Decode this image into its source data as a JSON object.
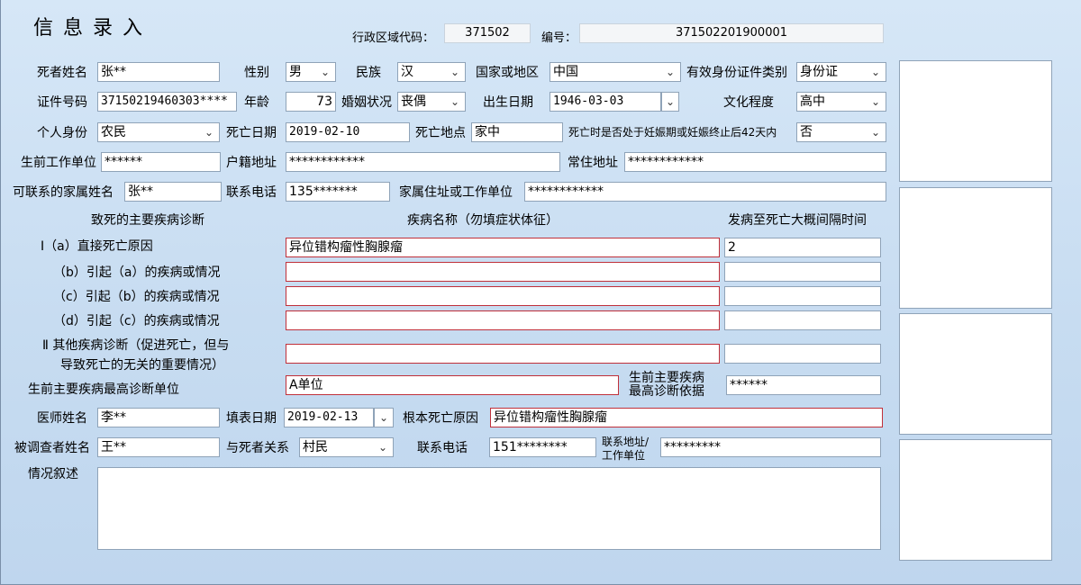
{
  "header": {
    "title": "信 息 录 入",
    "region_label": "行政区域代码：",
    "region_value": "371502",
    "id_label": "编号：",
    "id_value": "371502201900001"
  },
  "fields": {
    "deceased_name_label": "死者姓名",
    "deceased_name": "张**",
    "gender_label": "性别",
    "gender": "男",
    "ethnicity_label": "民族",
    "ethnicity": "汉",
    "country_label": "国家或地区",
    "country": "中国",
    "id_type_label": "有效身份证件类别",
    "id_type": "身份证",
    "id_no_label": "证件号码",
    "id_no": "37150219460303****",
    "age_label": "年龄",
    "age": "73",
    "marital_label": "婚姻状况",
    "marital": "丧偶",
    "birth_label": "出生日期",
    "birth": "1946-03-03",
    "education_label": "文化程度",
    "education": "高中",
    "identity_label": "个人身份",
    "identity": "农民",
    "death_date_label": "死亡日期",
    "death_date": "2019-02-10",
    "death_place_label": "死亡地点",
    "death_place": "家中",
    "pregnancy_label": "死亡时是否处于妊娠期或妊娠终止后42天内",
    "pregnancy": "否",
    "workplace_label": "生前工作单位",
    "workplace": "******",
    "household_label": "户籍地址",
    "household": "************",
    "residence_label": "常住地址",
    "residence": "************",
    "family_name_label": "可联系的家属姓名",
    "family_name": "张**",
    "phone_label": "联系电话",
    "phone": "135*******",
    "family_addr_label": "家属住址或工作单位",
    "family_addr": "************"
  },
  "diagnosis": {
    "col1": "致死的主要疾病诊断",
    "col2": "疾病名称（勿填症状体征）",
    "col3": "发病至死亡大概间隔时间",
    "rows": [
      {
        "label": "Ⅰ（a）直接死亡原因",
        "disease": "异位错构瘤性胸腺瘤",
        "interval": "2"
      },
      {
        "label": "（b）引起（a）的疾病或情况",
        "disease": "",
        "interval": ""
      },
      {
        "label": "（c）引起（b）的疾病或情况",
        "disease": "",
        "interval": ""
      },
      {
        "label": "（d）引起（c）的疾病或情况",
        "disease": "",
        "interval": ""
      }
    ],
    "other_label_1": "Ⅱ  其他疾病诊断（促进死亡，但与",
    "other_label_2": "导致死亡的无关的重要情况）",
    "other_disease": "",
    "other_interval": "",
    "top_unit_label": "生前主要疾病最高诊断单位",
    "top_unit": "A单位",
    "basis_label_1": "生前主要疾病",
    "basis_label_2": "最高诊断依据",
    "basis": "******"
  },
  "doctor": {
    "doctor_label": "医师姓名",
    "doctor": "李**",
    "fill_date_label": "填表日期",
    "fill_date": "2019-02-13",
    "root_cause_label": "根本死亡原因",
    "root_cause": "异位错构瘤性胸腺瘤",
    "respondent_label": "被调查者姓名",
    "respondent": "王**",
    "relation_label": "与死者关系",
    "relation": "村民",
    "resp_phone_label": "联系电话",
    "resp_phone": "151********",
    "resp_addr_label_1": "联系地址/",
    "resp_addr_label_2": "工作单位",
    "resp_addr": "*********",
    "narrative_label": "情况叙述",
    "narrative": ""
  },
  "icons": {
    "dropdown": "chevron-down-icon"
  }
}
